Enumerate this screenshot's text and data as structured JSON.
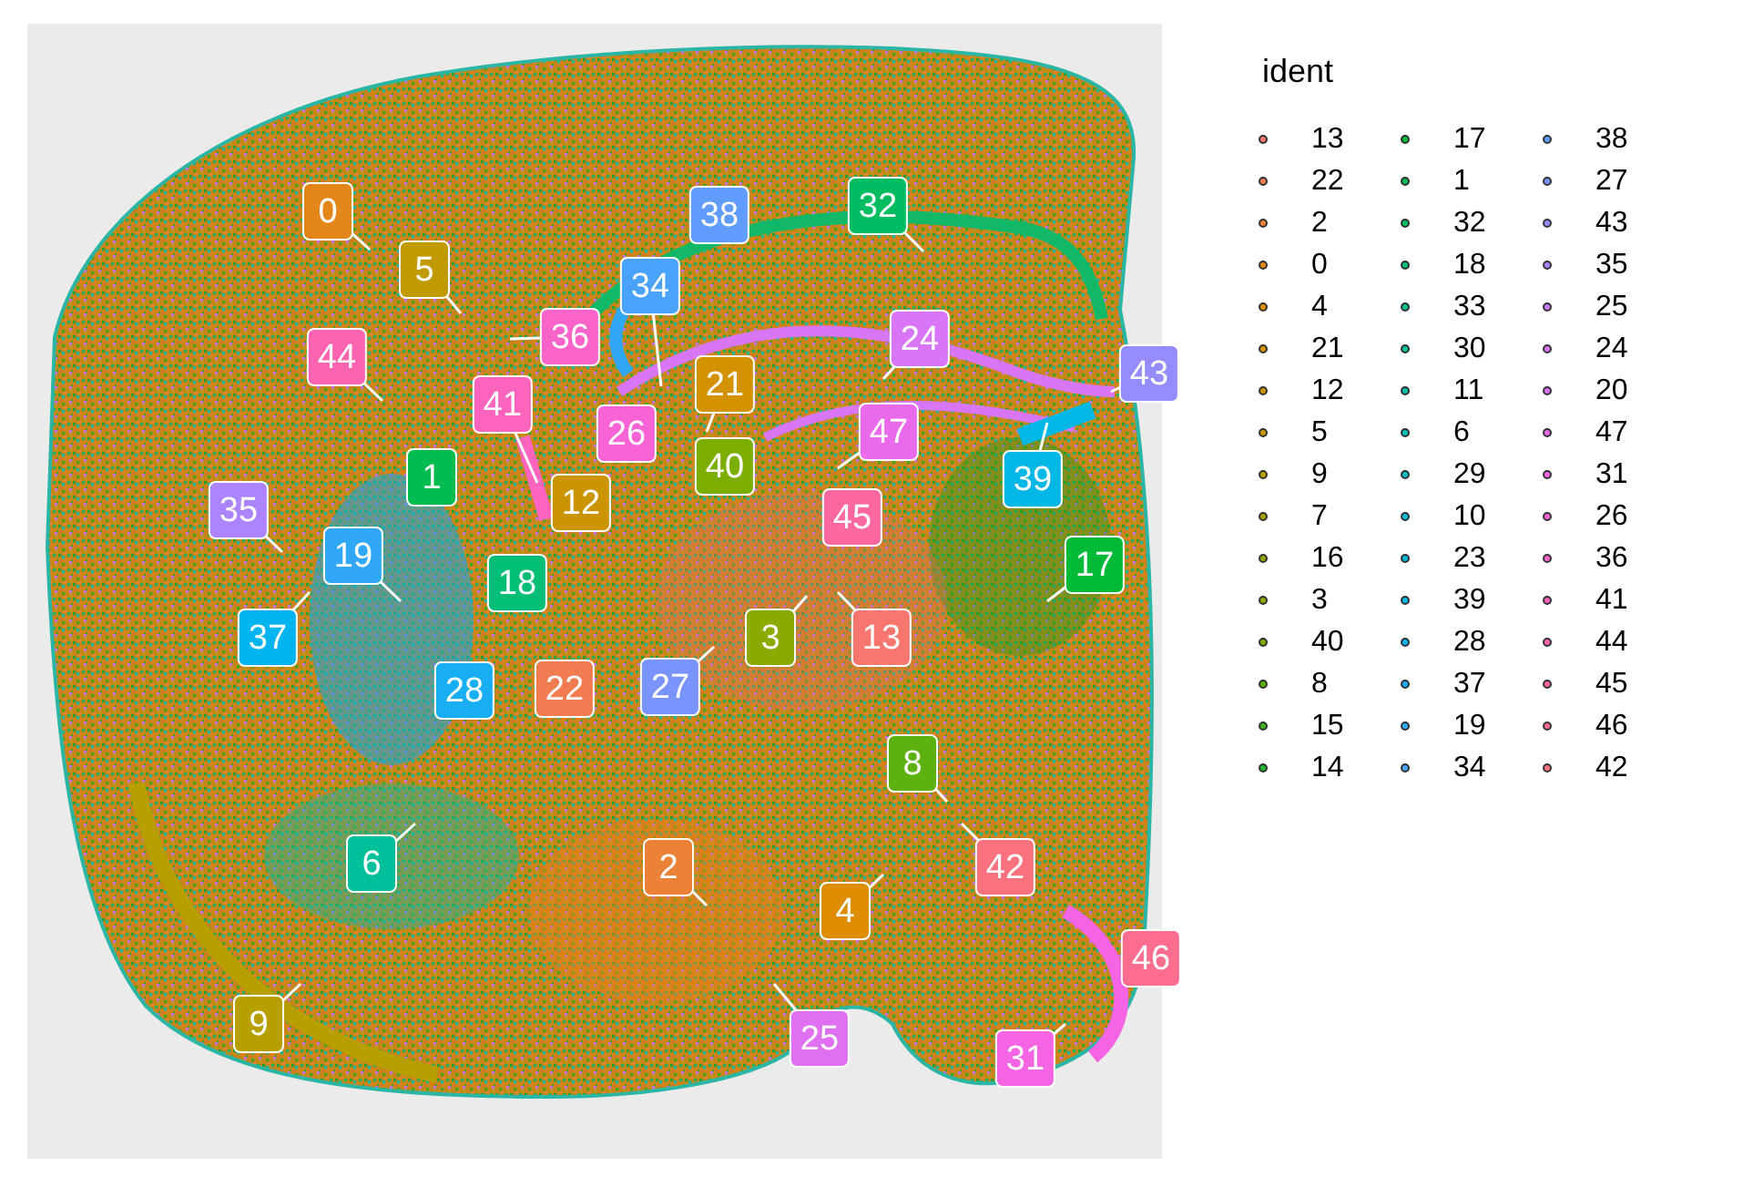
{
  "plot": {
    "labels": [
      {
        "text": "0",
        "color": "#e4871b"
      },
      {
        "text": "38",
        "color": "#619cff"
      },
      {
        "text": "32",
        "color": "#00bd62"
      },
      {
        "text": "5",
        "color": "#c19a00"
      },
      {
        "text": "34",
        "color": "#49a2fb"
      },
      {
        "text": "44",
        "color": "#ff64b0"
      },
      {
        "text": "36",
        "color": "#fa64ca"
      },
      {
        "text": "24",
        "color": "#d976f8"
      },
      {
        "text": "21",
        "color": "#d49100"
      },
      {
        "text": "43",
        "color": "#948cff"
      },
      {
        "text": "41",
        "color": "#fc64bd"
      },
      {
        "text": "26",
        "color": "#f864d6"
      },
      {
        "text": "47",
        "color": "#e96aea"
      },
      {
        "text": "1",
        "color": "#00bb4d"
      },
      {
        "text": "40",
        "color": "#7cae00"
      },
      {
        "text": "39",
        "color": "#00b7e5"
      },
      {
        "text": "35",
        "color": "#ad84ff"
      },
      {
        "text": "12",
        "color": "#ca9500"
      },
      {
        "text": "45",
        "color": "#fe689f"
      },
      {
        "text": "19",
        "color": "#30a8f7"
      },
      {
        "text": "18",
        "color": "#00be76"
      },
      {
        "text": "17",
        "color": "#00ba38"
      },
      {
        "text": "37",
        "color": "#00b4f0"
      },
      {
        "text": "3",
        "color": "#8baa00"
      },
      {
        "text": "13",
        "color": "#f8766d"
      },
      {
        "text": "28",
        "color": "#18aef4"
      },
      {
        "text": "22",
        "color": "#f27c52"
      },
      {
        "text": "27",
        "color": "#7a94ff"
      },
      {
        "text": "8",
        "color": "#5db10e"
      },
      {
        "text": "6",
        "color": "#00c099"
      },
      {
        "text": "2",
        "color": "#eb8137"
      },
      {
        "text": "42",
        "color": "#fa727e"
      },
      {
        "text": "4",
        "color": "#de8c00"
      },
      {
        "text": "46",
        "color": "#fc6d8e"
      },
      {
        "text": "9",
        "color": "#b79f00"
      },
      {
        "text": "25",
        "color": "#de70f1"
      },
      {
        "text": "31",
        "color": "#f564e3"
      }
    ]
  },
  "legend": {
    "title": "ident",
    "items": [
      {
        "label": "13",
        "color": "#f8766d"
      },
      {
        "label": "22",
        "color": "#f27c52"
      },
      {
        "label": "2",
        "color": "#eb8137"
      },
      {
        "label": "0",
        "color": "#e4871b"
      },
      {
        "label": "4",
        "color": "#de8c00"
      },
      {
        "label": "21",
        "color": "#d49100"
      },
      {
        "label": "12",
        "color": "#ca9500"
      },
      {
        "label": "5",
        "color": "#c19a00"
      },
      {
        "label": "9",
        "color": "#b79f00"
      },
      {
        "label": "7",
        "color": "#a8a300"
      },
      {
        "label": "16",
        "color": "#9aa600"
      },
      {
        "label": "3",
        "color": "#8baa00"
      },
      {
        "label": "40",
        "color": "#7cae00"
      },
      {
        "label": "8",
        "color": "#5db10e"
      },
      {
        "label": "15",
        "color": "#3eb41c"
      },
      {
        "label": "14",
        "color": "#1fb72a"
      },
      {
        "label": "17",
        "color": "#00ba38"
      },
      {
        "label": "1",
        "color": "#00bb4d"
      },
      {
        "label": "32",
        "color": "#00bd62"
      },
      {
        "label": "18",
        "color": "#00be76"
      },
      {
        "label": "33",
        "color": "#00c08b"
      },
      {
        "label": "30",
        "color": "#00c099"
      },
      {
        "label": "11",
        "color": "#00bfa7"
      },
      {
        "label": "6",
        "color": "#00bfb6"
      },
      {
        "label": "29",
        "color": "#00bfc4"
      },
      {
        "label": "10",
        "color": "#00bccf"
      },
      {
        "label": "23",
        "color": "#00b9da"
      },
      {
        "label": "39",
        "color": "#00b7e5"
      },
      {
        "label": "28",
        "color": "#00b4f0"
      },
      {
        "label": "37",
        "color": "#18aef4"
      },
      {
        "label": "19",
        "color": "#30a8f7"
      },
      {
        "label": "34",
        "color": "#49a2fb"
      },
      {
        "label": "38",
        "color": "#619cff"
      },
      {
        "label": "27",
        "color": "#7a94ff"
      },
      {
        "label": "43",
        "color": "#948cff"
      },
      {
        "label": "35",
        "color": "#ad84ff"
      },
      {
        "label": "25",
        "color": "#c77cff"
      },
      {
        "label": "24",
        "color": "#d976f8"
      },
      {
        "label": "20",
        "color": "#de70f1"
      },
      {
        "label": "47",
        "color": "#e96aea"
      },
      {
        "label": "31",
        "color": "#f564e3"
      },
      {
        "label": "26",
        "color": "#f864d6"
      },
      {
        "label": "36",
        "color": "#fa64ca"
      },
      {
        "label": "41",
        "color": "#fc64bd"
      },
      {
        "label": "44",
        "color": "#ff64b0"
      },
      {
        "label": "45",
        "color": "#fe689f"
      },
      {
        "label": "46",
        "color": "#fc6d8e"
      },
      {
        "label": "42",
        "color": "#fa727e"
      }
    ]
  }
}
